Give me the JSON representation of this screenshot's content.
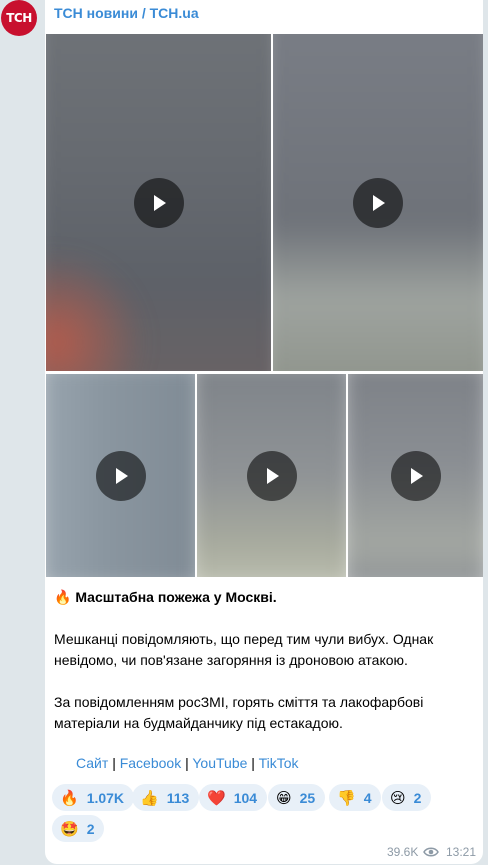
{
  "channel": {
    "name": "ТСН новини / TCH.ua",
    "avatar_text": "ТСН",
    "color": "#c8102e"
  },
  "post": {
    "title_emoji": "🔥",
    "title": "Масштабна пожежа у Москві.",
    "paragraph1": "Мешканці повідомляють, що перед тим чули вибух. Однак невідомо, чи пов'язане загоряння із дроновою атакою.",
    "paragraph2": "За повідомленням росЗМІ, горять сміття та лакофарбові матеріали на будмайданчику під естакадою.",
    "links": {
      "site": "Сайт",
      "facebook": "Facebook",
      "youtube": "YouTube",
      "tiktok": "TikTok",
      "separator": "|"
    }
  },
  "reactions": [
    {
      "emoji": "🔥",
      "count": "1.07K"
    },
    {
      "emoji": "👍",
      "count": "113"
    },
    {
      "emoji": "❤️",
      "count": "104"
    },
    {
      "emoji": "😁",
      "count": "25"
    },
    {
      "emoji": "👎",
      "count": "4"
    },
    {
      "emoji": "😢",
      "count": "2"
    },
    {
      "emoji": "🤩",
      "count": "2"
    }
  ],
  "views": "39.6K",
  "time": "13:21",
  "icons": [
    "play-icon",
    "eye-icon"
  ],
  "accent": "#3a8bd6"
}
